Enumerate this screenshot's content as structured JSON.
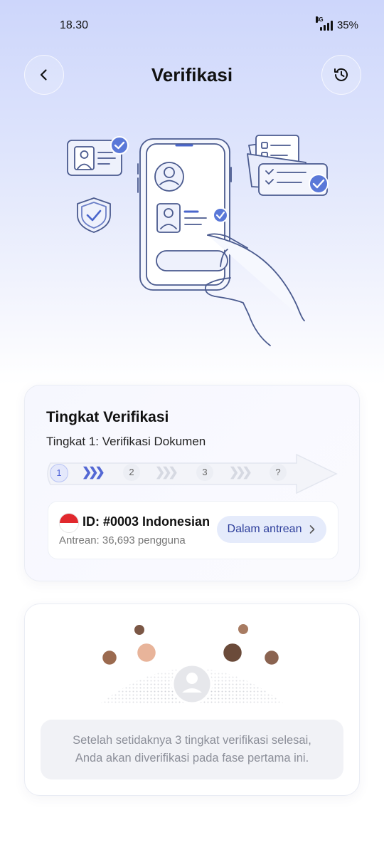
{
  "status_bar": {
    "time": "18.30",
    "network": "4G",
    "battery": "35%"
  },
  "header": {
    "title": "Verifikasi"
  },
  "icons": {
    "back": "chevron-left-icon",
    "history": "history-clock-icon"
  },
  "verification_card": {
    "title": "Tingkat Verifikasi",
    "subtitle": "Tingkat 1: Verifikasi Dokumen",
    "steps": [
      "1",
      "2",
      "3",
      "?"
    ],
    "active_step": "1",
    "id_label": "ID: #0003 Indonesian",
    "queue_text": "Antrean: 36,693 pengguna",
    "status_badge": "Dalam antrean",
    "colors": {
      "accent": "#5468d4",
      "badge_bg": "#e5ebfb",
      "badge_text": "#2d3e9b"
    }
  },
  "community_card": {
    "note_line_1": "Setelah setidaknya 3 tingkat verifikasi selesai,",
    "note_line_2": "Anda akan diverifikasi pada fase pertama ini."
  }
}
